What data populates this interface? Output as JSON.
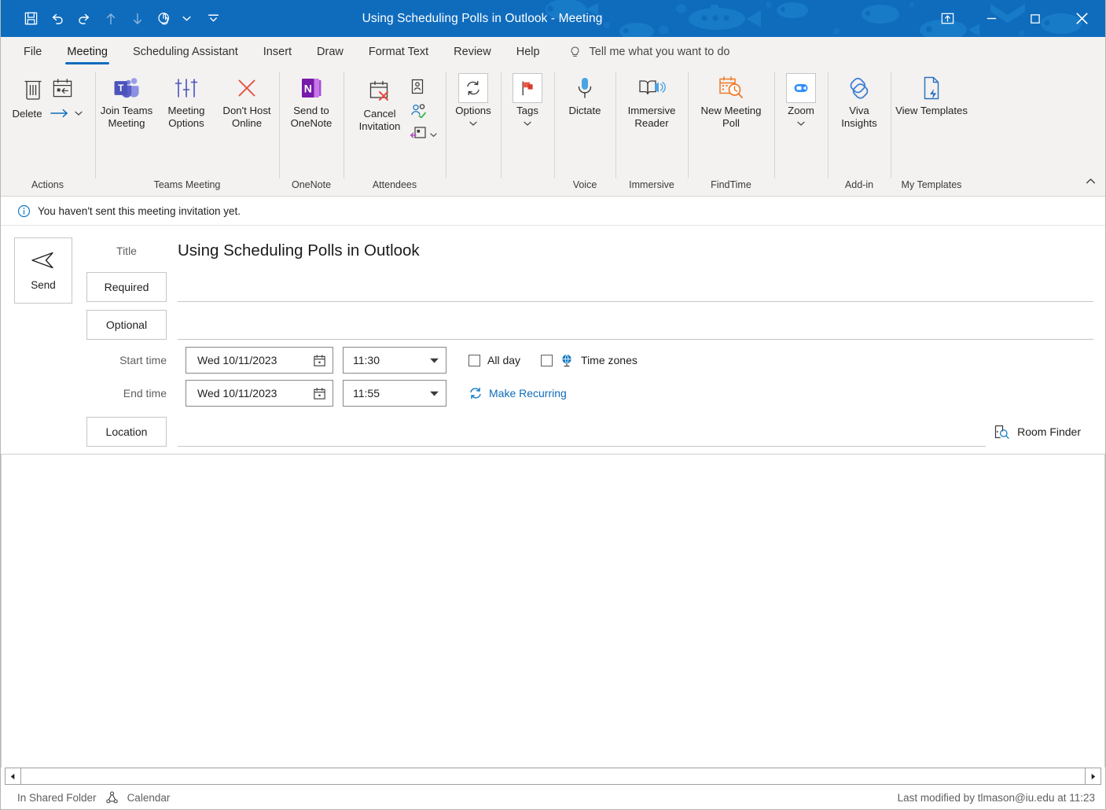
{
  "window": {
    "title": "Using Scheduling Polls in Outlook  -  Meeting",
    "quick_access": [
      {
        "name": "save-icon",
        "label": "Save"
      },
      {
        "name": "undo-icon",
        "label": "Undo"
      },
      {
        "name": "redo-icon",
        "label": "Redo"
      },
      {
        "name": "previous-item-icon",
        "label": "Previous Item"
      },
      {
        "name": "next-item-icon",
        "label": "Next Item"
      },
      {
        "name": "touch-mode-icon",
        "label": "Touch/Mouse Mode"
      }
    ],
    "controls": {
      "ribbon_display": "Ribbon Display Options",
      "minimize": "Minimize",
      "maximize": "Maximize",
      "close": "Close"
    },
    "accent_color": "#0f6cbd"
  },
  "tabs": [
    {
      "label": "File",
      "active": false
    },
    {
      "label": "Meeting",
      "active": true
    },
    {
      "label": "Scheduling Assistant",
      "active": false
    },
    {
      "label": "Insert",
      "active": false
    },
    {
      "label": "Draw",
      "active": false
    },
    {
      "label": "Format Text",
      "active": false
    },
    {
      "label": "Review",
      "active": false
    },
    {
      "label": "Help",
      "active": false
    }
  ],
  "tell_me": {
    "placeholder": "Tell me what you want to do",
    "icon": "lightbulb-icon"
  },
  "ribbon": {
    "groups": [
      {
        "label": "Actions",
        "buttons": [
          {
            "label": "Delete",
            "icon": "trash-icon"
          },
          {
            "label": "",
            "icon": "calendar-forward-icon"
          },
          {
            "label": "",
            "icon": "forward-arrow-icon"
          },
          {
            "label": "",
            "icon": "chevron-down-icon"
          }
        ]
      },
      {
        "label": "Teams Meeting",
        "buttons": [
          {
            "label": "Join Teams Meeting",
            "icon": "teams-icon"
          },
          {
            "label": "Meeting Options",
            "icon": "sliders-icon"
          },
          {
            "label": "Don't Host Online",
            "icon": "red-x-icon"
          }
        ]
      },
      {
        "label": "OneNote",
        "buttons": [
          {
            "label": "Send to OneNote",
            "icon": "onenote-icon"
          }
        ]
      },
      {
        "label": "Attendees",
        "buttons": [
          {
            "label": "Cancel Invitation",
            "icon": "calendar-cancel-icon"
          },
          {
            "label": "",
            "icon": "address-book-icon"
          },
          {
            "label": "",
            "icon": "check-names-icon"
          },
          {
            "label": "",
            "icon": "response-options-icon"
          },
          {
            "label": "",
            "icon": "chevron-down-icon"
          }
        ]
      },
      {
        "label": "",
        "buttons": [
          {
            "label": "Options",
            "icon": "options-refresh-icon",
            "chevron": "⌄"
          }
        ]
      },
      {
        "label": "",
        "buttons": [
          {
            "label": "Tags",
            "icon": "red-flag-icon",
            "chevron": "⌄"
          }
        ]
      },
      {
        "label": "Voice",
        "buttons": [
          {
            "label": "Dictate",
            "icon": "microphone-icon"
          }
        ]
      },
      {
        "label": "Immersive",
        "buttons": [
          {
            "label": "Immersive Reader",
            "icon": "immersive-reader-icon"
          }
        ]
      },
      {
        "label": "FindTime",
        "buttons": [
          {
            "label": "New Meeting Poll",
            "icon": "findtime-icon"
          }
        ]
      },
      {
        "label": "",
        "buttons": [
          {
            "label": "Zoom",
            "icon": "zoom-camera-icon",
            "chevron": "⌄"
          }
        ]
      },
      {
        "label": "Add-in",
        "buttons": [
          {
            "label": "Viva Insights",
            "icon": "viva-insights-icon"
          }
        ]
      },
      {
        "label": "My Templates",
        "buttons": [
          {
            "label": "View Templates",
            "icon": "templates-icon"
          }
        ]
      }
    ],
    "collapse_icon": "chevron-up-icon"
  },
  "info_bar": {
    "icon": "info-icon",
    "message": "You haven't sent this meeting invitation yet."
  },
  "form": {
    "send_button": "Send",
    "send_icon": "send-arrow-icon",
    "title_label": "Title",
    "title_value": "Using Scheduling Polls in Outlook",
    "required_label": "Required",
    "required_value": "",
    "optional_label": "Optional",
    "optional_value": "",
    "start_time_label": "Start time",
    "start_date": "Wed 10/11/2023",
    "start_time": "11:30",
    "end_time_label": "End time",
    "end_date": "Wed 10/11/2023",
    "end_time": "11:55",
    "all_day_label": "All day",
    "all_day_checked": false,
    "time_zones_label": "Time zones",
    "time_zones_checked": false,
    "time_zones_icon": "globe-icon",
    "make_recurring_label": "Make Recurring",
    "make_recurring_icon": "recurrence-icon",
    "location_label": "Location",
    "location_value": "",
    "room_finder_label": "Room Finder",
    "room_finder_icon": "room-finder-icon",
    "calendar_icon": "calendar-picker-icon",
    "dropdown_icon": "chevron-down-icon",
    "link_color": "#0f6cbd"
  },
  "body": {
    "content": ""
  },
  "status_bar": {
    "shared_folder_label": "In Shared Folder",
    "folder_icon": "shared-calendar-icon",
    "folder_name": "Calendar",
    "last_modified": "Last modified by tlmason@iu.edu at 11:23"
  },
  "scrollbar": {
    "left_arrow": "scroll-left-icon",
    "right_arrow": "scroll-right-icon"
  }
}
